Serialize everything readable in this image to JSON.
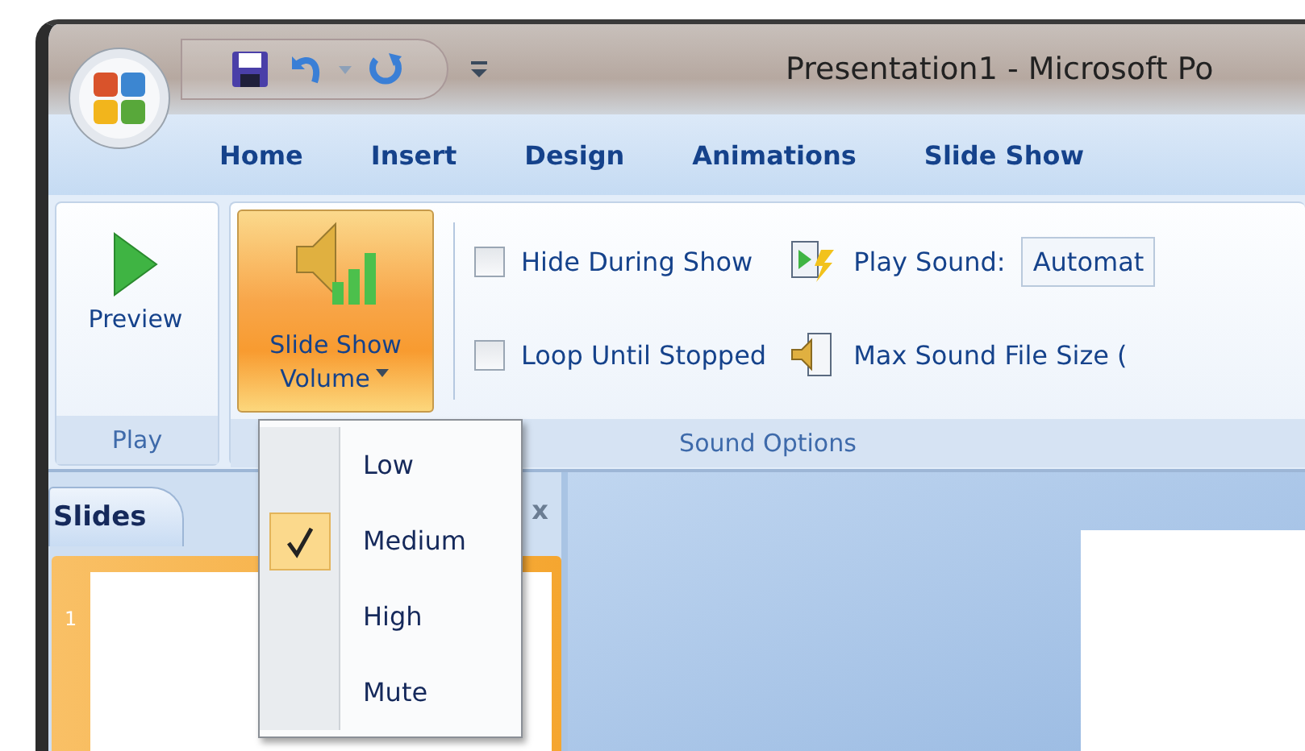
{
  "window": {
    "title": "Presentation1 - Microsoft Po"
  },
  "tabs": [
    {
      "label": "Home"
    },
    {
      "label": "Insert"
    },
    {
      "label": "Design"
    },
    {
      "label": "Animations"
    },
    {
      "label": "Slide Show"
    }
  ],
  "ribbon": {
    "groups": [
      {
        "kind": "play",
        "label": "Play",
        "button": "Preview"
      },
      {
        "kind": "sound",
        "label": "Sound Options",
        "volume_button": [
          "Slide Show",
          "Volume"
        ],
        "checkboxes": [
          {
            "label": "Hide During Show",
            "checked": false
          },
          {
            "label": "Loop Until Stopped",
            "checked": false
          }
        ],
        "play_sound": {
          "label": "Play Sound:",
          "value": "Automat"
        },
        "max_size": {
          "label": "Max Sound File Size ("
        }
      }
    ]
  },
  "volume_menu": [
    {
      "label": "Low",
      "checked": false
    },
    {
      "label": "Medium",
      "checked": true
    },
    {
      "label": "High",
      "checked": false
    },
    {
      "label": "Mute",
      "checked": false
    }
  ],
  "slides_pane": {
    "tabs": [
      {
        "label": "Slides",
        "selected": true
      }
    ],
    "close": "x",
    "thumbnails": [
      {
        "number": "1"
      }
    ]
  }
}
